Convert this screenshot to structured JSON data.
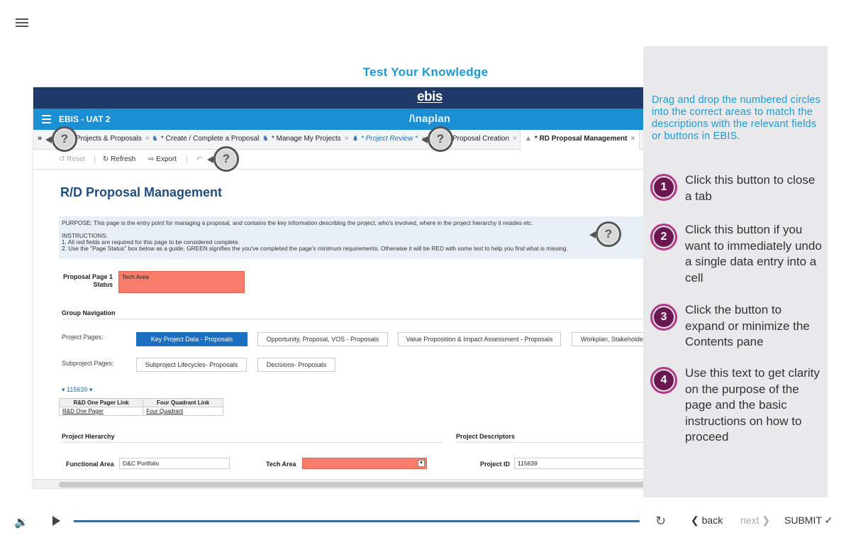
{
  "page_title": "Test Your Knowledge",
  "ebis_logo": "ebis",
  "app_bar": {
    "app_name": "EBIS - UAT 2",
    "brand": "/\\naplan"
  },
  "tabs": [
    {
      "label": "Projects & Proposals",
      "icon": "",
      "italic": false
    },
    {
      "label": "* Create / Complete a Proposal",
      "icon": "user-icon",
      "italic": false
    },
    {
      "label": "* Manage My Projects",
      "icon": "user-icon",
      "italic": false
    },
    {
      "label": "* Project Review *",
      "icon": "user-icon",
      "italic": true
    },
    {
      "label": "Proposal Creation",
      "icon": "",
      "italic": false
    },
    {
      "label": "* RD Proposal Management",
      "icon": "pin-icon",
      "italic": false
    }
  ],
  "toolbar": {
    "reset": "Reset",
    "refresh": "Refresh",
    "export": "Export"
  },
  "rd": {
    "title": "R/D Proposal Management",
    "purpose": "PURPOSE: This page is the entry point for managing a proposal, and contains the key information describing the project, who's involved, where in the project hierarchy it resides etc.",
    "instructions_heading": "INSTRUCTIONS:",
    "instruction_1": "1. All red fields are required for this page to be considered complete.",
    "instruction_2": "2. Use the \"Page Status\" box below as a guide. GREEN signifies the you've completed the page's minimum requirements. Otherwise it will be RED with some text to help you find what is missing.",
    "status_label_1": "Proposal Page 1",
    "status_label_2": "Status",
    "status_value": "Tech Area",
    "group_navigation": "Group Navigation",
    "project_pages_label": "Project Pages:",
    "project_pages": [
      "Key Project Data - Proposals",
      "Opportunity, Proposal, VOS - Proposals",
      "Value Proposition & Impact Assessment - Proposals",
      "Workplan, Stakeholder"
    ],
    "subproject_pages_label": "Subproject Pages:",
    "subproject_pages": [
      "Subproject Lifecycles- Proposals",
      "Decisions- Proposals"
    ],
    "project_id_toggle": "115639",
    "pager_headers": [
      "R&D One Pager Link",
      "Four Quadrant Link"
    ],
    "pager_values": [
      "R&D One Pager",
      "Four Quadrant"
    ],
    "project_hierarchy": "Project Hierarchy",
    "project_descriptors": "Project Descriptors",
    "functional_area_label": "Functional Area",
    "functional_area_value": "D&C Portfolio",
    "tech_area_label": "Tech Area",
    "project_id_label": "Project ID",
    "project_id_value": "115639"
  },
  "hotspot_symbol": "?",
  "panel": {
    "instruction": "Drag and drop the numbered circles into the correct areas to match the descriptions with the relevant fields or buttons in EBIS.",
    "items": [
      {
        "num": "1",
        "text": "Click this button to close a tab"
      },
      {
        "num": "2",
        "text": "Click this button if you want to immediately undo a single data entry into a cell"
      },
      {
        "num": "3",
        "text": "Click the button to expand or minimize the Contents pane"
      },
      {
        "num": "4",
        "text": "Use this text to get clarity on the purpose of the page and the basic instructions on how to proceed"
      }
    ]
  },
  "player": {
    "back": "back",
    "next": "next",
    "submit": "SUBMIT",
    "progress_fraction": 1.0
  }
}
